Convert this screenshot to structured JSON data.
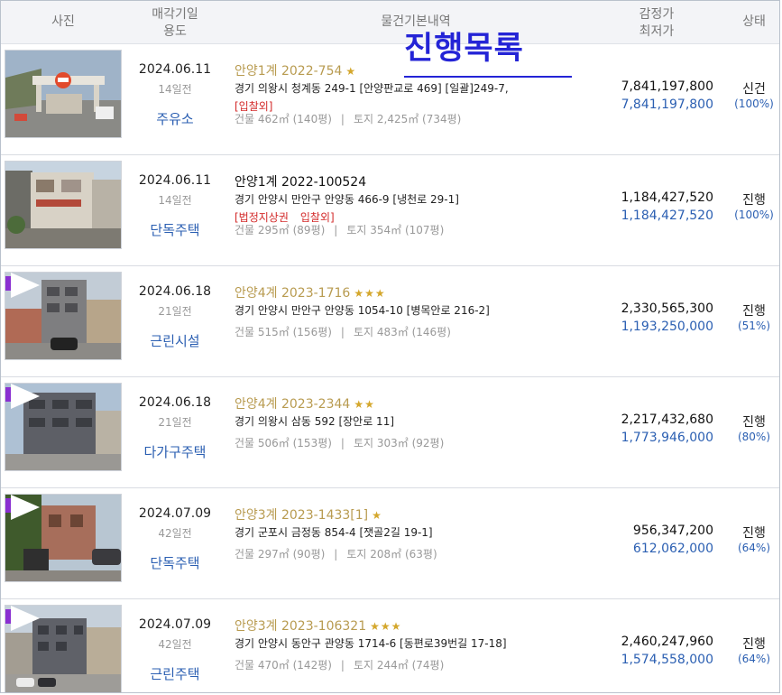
{
  "header": {
    "photo": "사진",
    "date_line1": "매각기일",
    "date_line2": "용도",
    "info": "물건기본내역",
    "price_line1": "감정가",
    "price_line2": "최저가",
    "status": "상태"
  },
  "banner": "진행목록",
  "colors": {
    "accent": "#2424d6",
    "link_blue": "#2b5fb2",
    "gold": "#b89b50",
    "red": "#d32a2a"
  },
  "rows": [
    {
      "date": "2024.06.11",
      "days": "14일전",
      "usage": "주유소",
      "case": "안양1계 2022-754",
      "stars": "★",
      "address": "경기 의왕시 청계동 249-1 [안양판교로 469] [일괄]249-7,",
      "tags": [
        "[입찰외]"
      ],
      "building": "건물 462㎡ (140평)",
      "land": "토지 2,425㎡ (734평)",
      "appraisal": "7,841,197,800",
      "minimum": "7,841,197,800",
      "status": "신건",
      "pct": "(100%)"
    },
    {
      "date": "2024.06.11",
      "days": "14일전",
      "usage": "단독주택",
      "case": "안양1계 2022-100524",
      "stars": "",
      "address": "경기 안양시 만안구 안양동 466-9 [냉천로 29-1]",
      "tags": [
        "[법정지상권",
        "입찰외]"
      ],
      "building": "건물 295㎡ (89평)",
      "land": "토지 354㎡ (107평)",
      "appraisal": "1,184,427,520",
      "minimum": "1,184,427,520",
      "status": "진행",
      "pct": "(100%)"
    },
    {
      "date": "2024.06.18",
      "days": "21일전",
      "usage": "근린시설",
      "case": "안양4계 2023-1716",
      "stars": "★★★",
      "address": "경기 안양시 만안구 안양동 1054-10 [병목안로 216-2]",
      "tags": [],
      "building": "건물 515㎡ (156평)",
      "land": "토지 483㎡ (146평)",
      "appraisal": "2,330,565,300",
      "minimum": "1,193,250,000",
      "status": "진행",
      "pct": "(51%)"
    },
    {
      "date": "2024.06.18",
      "days": "21일전",
      "usage": "다가구주택",
      "case": "안양4계 2023-2344",
      "stars": "★★",
      "address": "경기 의왕시 삼동 592 [장안로 11]",
      "tags": [],
      "building": "건물 506㎡ (153평)",
      "land": "토지 303㎡ (92평)",
      "appraisal": "2,217,432,680",
      "minimum": "1,773,946,000",
      "status": "진행",
      "pct": "(80%)"
    },
    {
      "date": "2024.07.09",
      "days": "42일전",
      "usage": "단독주택",
      "case": "안양3계 2023-1433[1]",
      "stars": "★",
      "address": "경기 군포시 금정동 854-4 [잿골2길 19-1]",
      "tags": [],
      "building": "건물 297㎡ (90평)",
      "land": "토지 208㎡ (63평)",
      "appraisal": "956,347,200",
      "minimum": "612,062,000",
      "status": "진행",
      "pct": "(64%)"
    },
    {
      "date": "2024.07.09",
      "days": "42일전",
      "usage": "근린주택",
      "case": "안양3계 2023-106321",
      "stars": "★★★",
      "address": "경기 안양시 동안구 관양동 1714-6 [동편로39번길 17-18]",
      "tags": [],
      "building": "건물 470㎡ (142평)",
      "land": "토지 244㎡ (74평)",
      "appraisal": "2,460,247,960",
      "minimum": "1,574,558,000",
      "status": "진행",
      "pct": "(64%)"
    }
  ]
}
